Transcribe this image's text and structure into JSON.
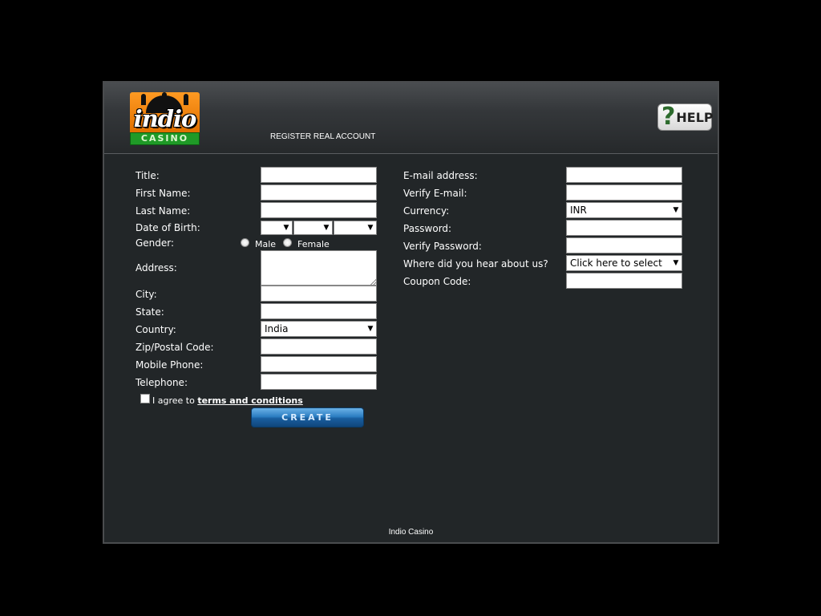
{
  "header": {
    "logo_main": "indio",
    "logo_sub": "CASINO",
    "title": "REGISTER REAL ACCOUNT",
    "help_label": "HELP",
    "help_mark": "?"
  },
  "left": {
    "title_label": "Title:",
    "first_name_label": "First Name:",
    "last_name_label": "Last Name:",
    "dob_label": "Date of Birth:",
    "gender_label": "Gender:",
    "gender_male": "Male",
    "gender_female": "Female",
    "address_label": "Address:",
    "city_label": "City:",
    "state_label": "State:",
    "country_label": "Country:",
    "country_value": "India",
    "zip_label": "Zip/Postal Code:",
    "mobile_label": "Mobile Phone:",
    "telephone_label": "Telephone:"
  },
  "right": {
    "email_label": "E-mail address:",
    "verify_email_label": "Verify E-mail:",
    "currency_label": "Currency:",
    "currency_value": "INR",
    "password_label": "Password:",
    "verify_password_label": "Verify Password:",
    "hear_label": "Where did you hear about us?",
    "hear_value": "Click here to select",
    "coupon_label": "Coupon Code:"
  },
  "terms": {
    "prefix": "I agree to ",
    "link": "terms and conditions"
  },
  "create_label": "CREATE",
  "footer": "Indio Casino",
  "icons": {
    "dropdown": "▼"
  }
}
